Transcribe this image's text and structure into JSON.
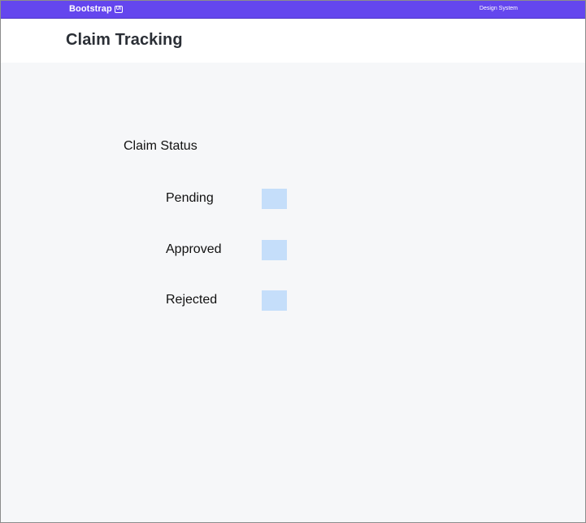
{
  "app": {
    "brand": "Bootstrap",
    "brand_badge": "UI",
    "nav_link": "Design System"
  },
  "page": {
    "title": "Claim Tracking"
  },
  "claim_status": {
    "title": "Claim Status",
    "items": [
      {
        "label": "Pending",
        "swatch_color": "#c5defa"
      },
      {
        "label": "Approved",
        "swatch_color": "#c5defa"
      },
      {
        "label": "Rejected",
        "swatch_color": "#c5defa"
      }
    ]
  },
  "colors": {
    "topbar": "#6446ee",
    "background": "#f6f7f9",
    "header": "#ffffff",
    "text": "#2b2f36"
  }
}
